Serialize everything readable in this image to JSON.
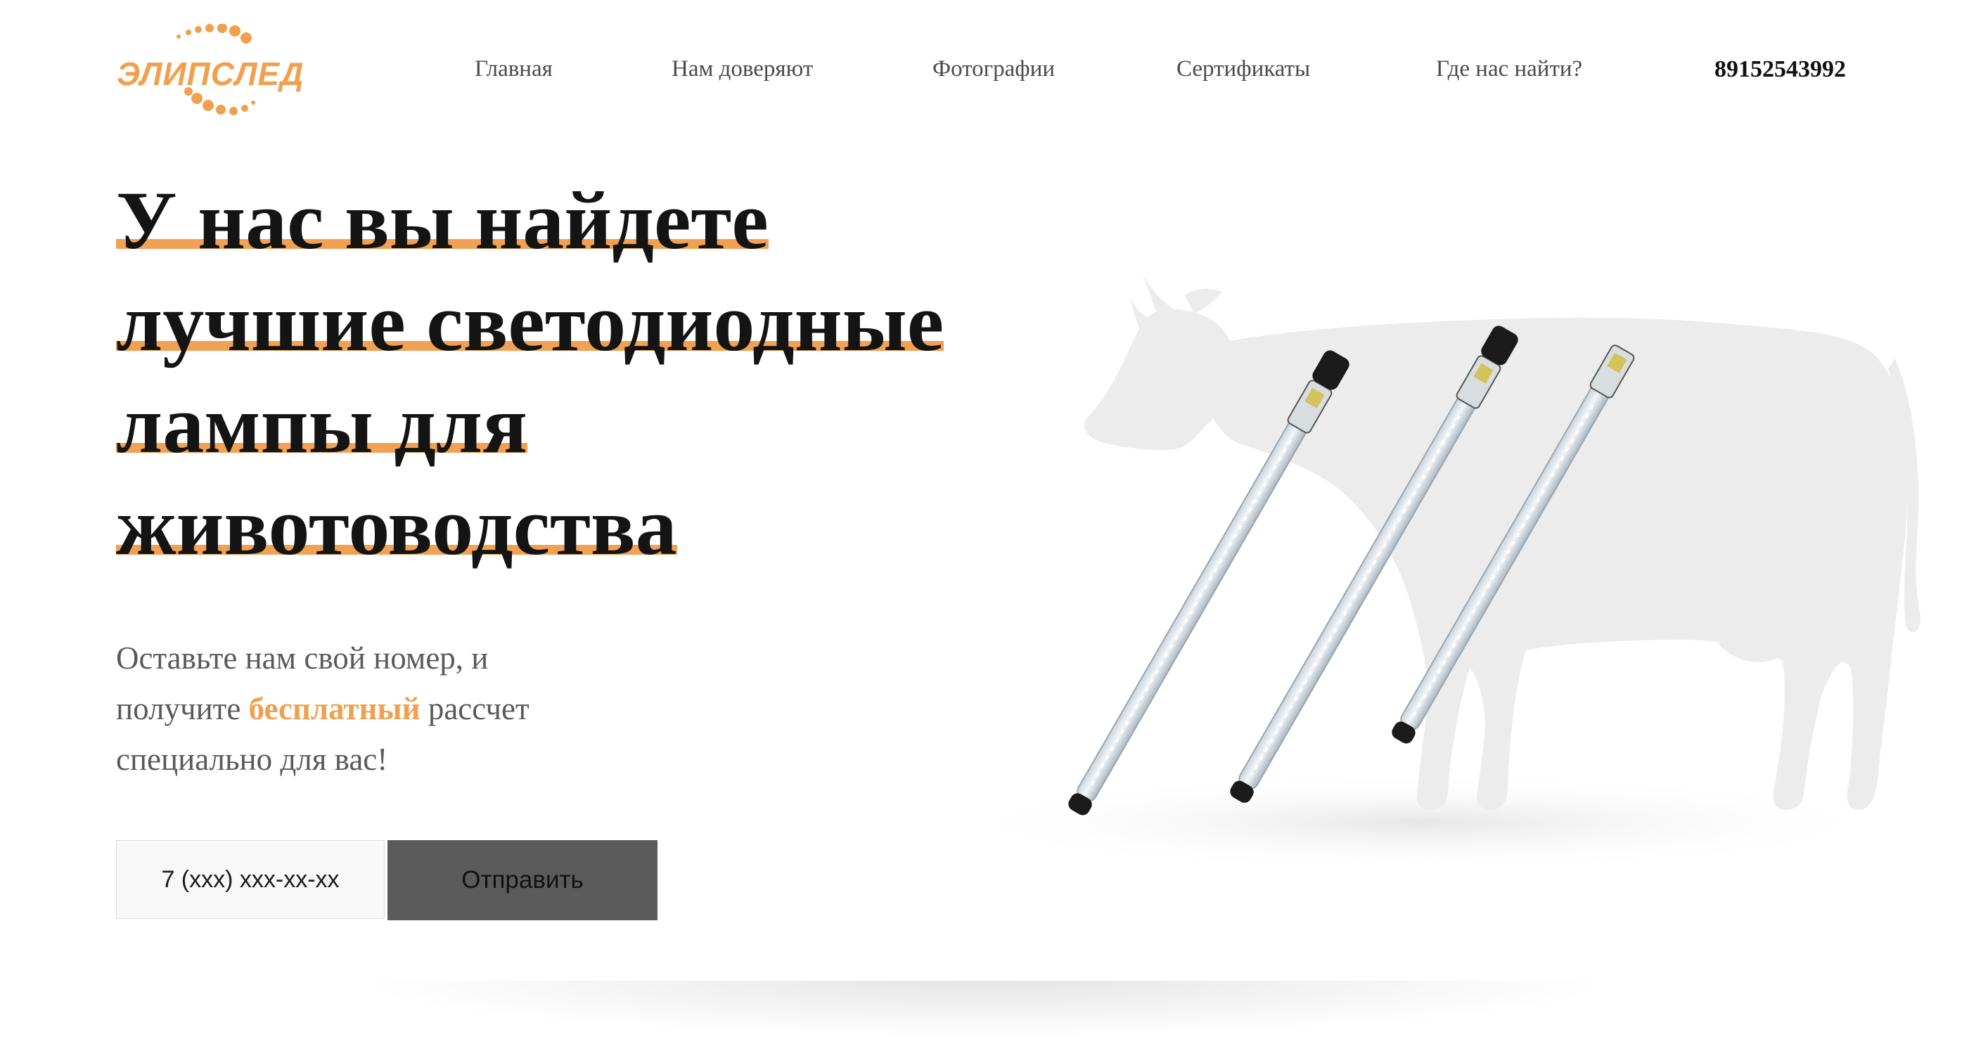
{
  "brand": {
    "logo_text": "ЭЛИПСЛЕД",
    "accent_color": "#f0a04e"
  },
  "nav": {
    "items": [
      {
        "label": "Главная"
      },
      {
        "label": "Нам доверяют"
      },
      {
        "label": "Фотографии"
      },
      {
        "label": "Сертификаты"
      },
      {
        "label": "Где нас найти?"
      }
    ],
    "phone": "89152543992"
  },
  "hero": {
    "headline_lines": [
      "У нас вы найдете",
      "лучшие светодиодные",
      "лампы для",
      "животоводства"
    ],
    "sub_before": "Оставьте нам свой номер, и",
    "sub_mid_pre": "получите ",
    "sub_highlight": "бесплатный",
    "sub_mid_post": " рассчет",
    "sub_after": "специально для вас!",
    "image_icons": [
      "cow-silhouette",
      "led-tube-lamp"
    ]
  },
  "form": {
    "phone_placeholder": "7 (xxx) xxx-xx-xx",
    "submit_label": "Отправить",
    "button_color": "#5b5b5b"
  }
}
